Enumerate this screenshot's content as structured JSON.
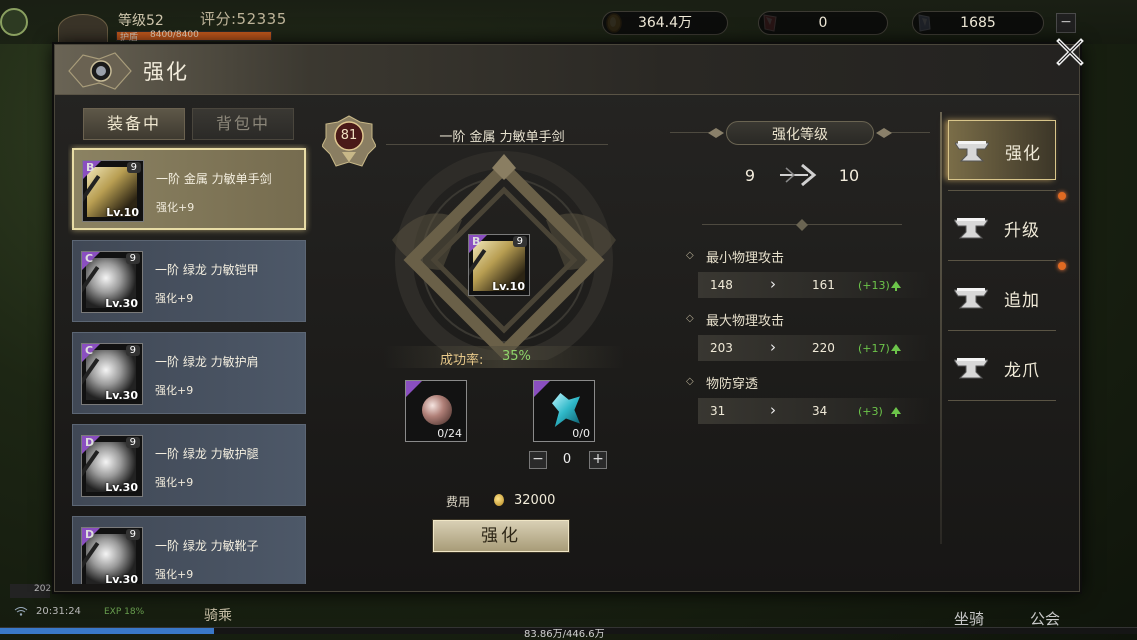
{
  "hud": {
    "level": "等级52",
    "score": "评分:52335",
    "hp_label": "护盾",
    "hp_text": "8400/8400",
    "hp_fraction": 1.0,
    "gold": "364.4万",
    "gem": "0",
    "crystal": "1685",
    "minimize": "−",
    "time_box": "202",
    "time": "20:31:24",
    "exp_label": "EXP 18%",
    "exp_text": "83.86万/446.6万",
    "exp_fraction": 0.188,
    "left_btn": "骑乘",
    "mount_btn": "坐骑",
    "guild_btn": "公会"
  },
  "panel": {
    "title": "强化",
    "close_icon": "close-x-icon"
  },
  "tabs": {
    "equipped": "装备中",
    "bag": "背包中"
  },
  "items": [
    {
      "name": "一阶 金属 力敏单手剑",
      "enh": "强化+9",
      "grade": "B",
      "plus": "9",
      "lv": "Lv.10",
      "selected": true
    },
    {
      "name": "一阶 绿龙 力敏铠甲",
      "enh": "强化+9",
      "grade": "C",
      "plus": "9",
      "lv": "Lv.30",
      "selected": false
    },
    {
      "name": "一阶 绿龙 力敏护肩",
      "enh": "强化+9",
      "grade": "C",
      "plus": "9",
      "lv": "Lv.30",
      "selected": false
    },
    {
      "name": "一阶 绿龙 力敏护腿",
      "enh": "强化+9",
      "grade": "D",
      "plus": "9",
      "lv": "Lv.30",
      "selected": false
    },
    {
      "name": "一阶 绿龙 力敏靴子",
      "enh": "强化+9",
      "grade": "D",
      "plus": "9",
      "lv": "Lv.30",
      "selected": false
    }
  ],
  "center": {
    "player_level": "81",
    "item_name": "一阶 金属 力敏单手剑",
    "item_grade": "B",
    "item_plus": "9",
    "item_lv": "Lv.10",
    "rate_label": "成功率:",
    "rate_value": "35%",
    "stone_count": "0/24",
    "crystal_count": "0/0",
    "stepper_value": "0",
    "stepper_minus": "−",
    "stepper_plus": "+",
    "cost_label": "费用",
    "cost_value": "32000",
    "enhance_button": "强化"
  },
  "stats": {
    "level_title": "强化等级",
    "level_from": "9",
    "level_to": "10",
    "arrow": "›",
    "bullet": "◇",
    "rows": [
      {
        "label": "最小物理攻击",
        "old": "148",
        "new": "161",
        "diff": "(+13)"
      },
      {
        "label": "最大物理攻击",
        "old": "203",
        "new": "220",
        "diff": "(+17)"
      },
      {
        "label": "物防穿透",
        "old": "31",
        "new": "34",
        "diff": "(+3)"
      }
    ]
  },
  "side_tabs": [
    {
      "label": "强化",
      "active": true,
      "badge": false
    },
    {
      "label": "升级",
      "active": false,
      "badge": true
    },
    {
      "label": "追加",
      "active": false,
      "badge": true
    },
    {
      "label": "龙爪",
      "active": false,
      "badge": false
    }
  ],
  "colors": {
    "accent_gold": "#e8dca5",
    "rate_green": "#8fd46a",
    "diff_green": "#6cc44a",
    "badge_orange": "#e06a22",
    "rare_purple": "#8a4fc0"
  }
}
